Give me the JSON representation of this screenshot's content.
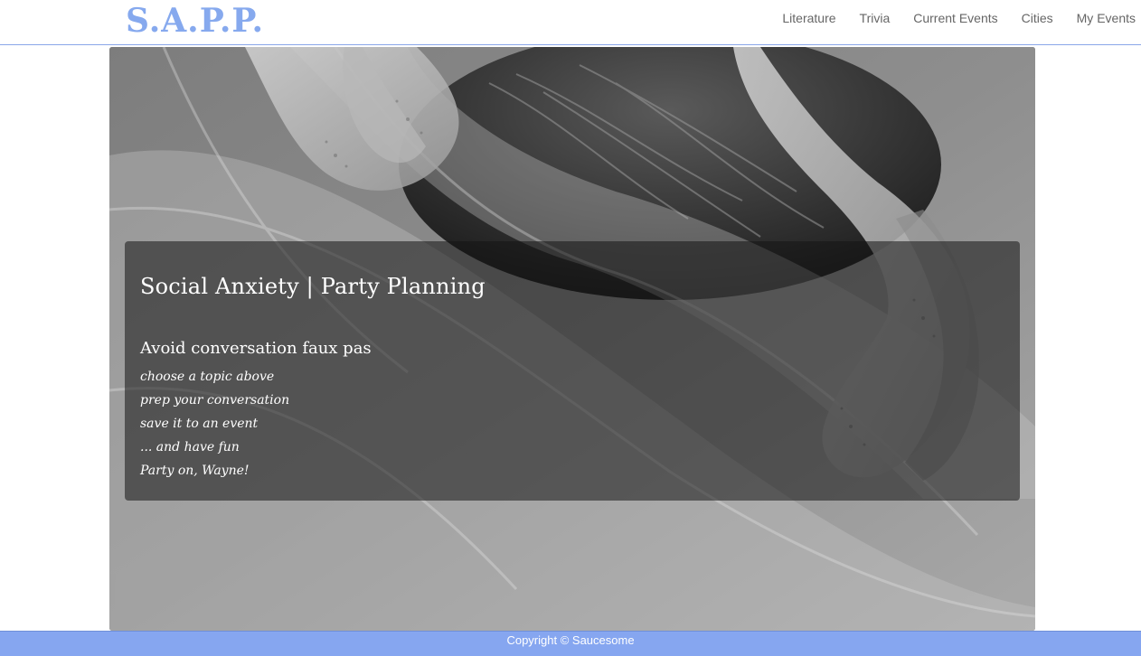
{
  "navbar": {
    "brand": "S.A.P.P.",
    "links": [
      "Literature",
      "Trivia",
      "Current Events",
      "Cities",
      "My Events"
    ]
  },
  "hero": {
    "title": "Social Anxiety | Party Planning",
    "subtitle": "Avoid conversation faux pas",
    "steps": [
      "choose a topic above",
      "prep your conversation",
      "save it to an event",
      "... and have fun",
      "Party on, Wayne!"
    ]
  },
  "footer": {
    "copyright": "Copyright © Saucesome"
  },
  "colors": {
    "brand": "#86a9ee",
    "footer_bg": "#86a6f0",
    "nav_text": "#666666"
  }
}
